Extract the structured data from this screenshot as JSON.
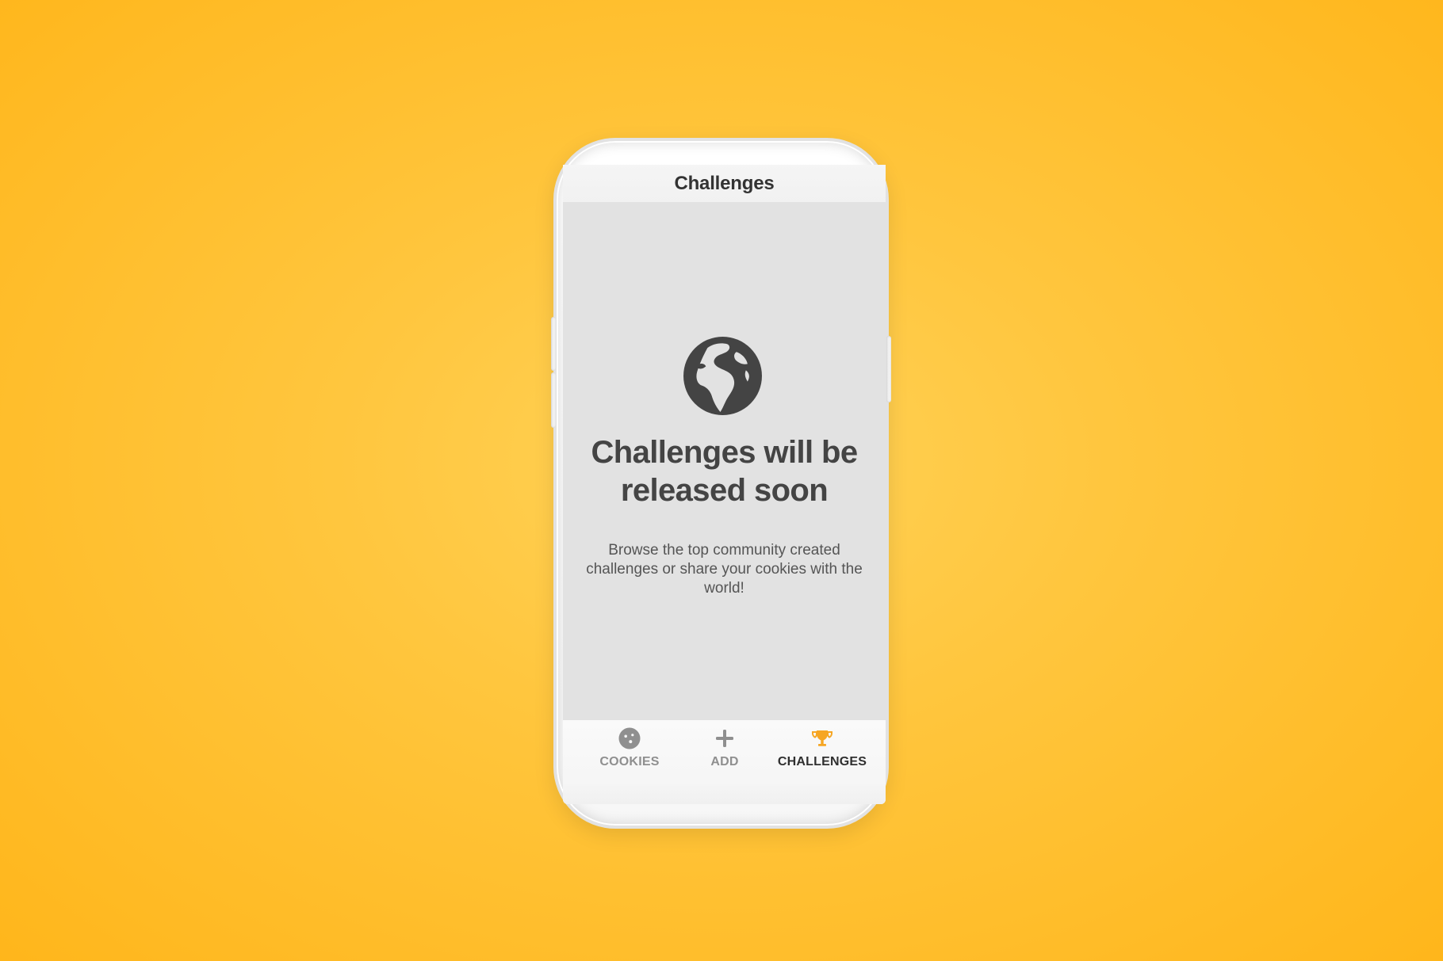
{
  "app": {
    "header_title": "Challenges"
  },
  "hero": {
    "icon": "globe-icon",
    "title": "Challenges will be released soon",
    "description": "Browse the top community created challenges or share your cookies with the world!"
  },
  "bottom_nav": {
    "items": [
      {
        "label": "COOKIES",
        "icon": "cookie-icon",
        "active": false
      },
      {
        "label": "ADD",
        "icon": "plus-icon",
        "active": false
      },
      {
        "label": "CHALLENGES",
        "icon": "trophy-icon",
        "active": true
      }
    ]
  },
  "colors": {
    "background_primary": "#ffc63e",
    "background_edge": "#ffb61b",
    "screen_background": "#e2e2e2",
    "active_icon": "#f6a623",
    "text_primary": "#444444",
    "text_secondary": "#555555",
    "inactive_nav": "#8f8f8f"
  }
}
